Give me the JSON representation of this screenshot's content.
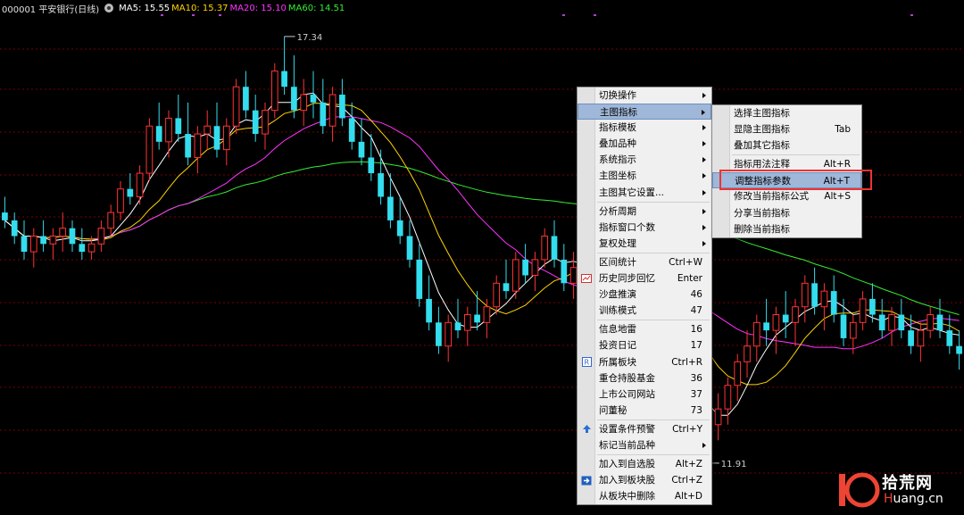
{
  "header": {
    "title": "000001 平安银行(日线)",
    "ma": [
      {
        "label": "MA5: 15.55",
        "color": "#ffffff"
      },
      {
        "label": "MA10: 15.37",
        "color": "#ffd400"
      },
      {
        "label": "MA20: 15.10",
        "color": "#ff33ff"
      },
      {
        "label": "MA60: 14.51",
        "color": "#33ee33"
      }
    ]
  },
  "annotations": {
    "high": "17.34",
    "low": "11.91"
  },
  "colors": {
    "up": "#ff3333",
    "down": "#33ddee",
    "grid": "#7a0000",
    "ma5": "#ffffff",
    "ma10": "#ffd400",
    "ma20": "#ff33ff",
    "ma60": "#33ee33"
  },
  "main_menu": {
    "items": [
      {
        "label": "切换操作",
        "arrow": true
      },
      {
        "label": "主图指标",
        "arrow": true,
        "highlight": true
      },
      {
        "label": "指标模板",
        "arrow": true
      },
      {
        "label": "叠加品种",
        "arrow": true
      },
      {
        "label": "系统指示",
        "arrow": true
      },
      {
        "label": "主图坐标",
        "arrow": true
      },
      {
        "label": "主图其它设置...",
        "arrow": true,
        "sep_after": true
      },
      {
        "label": "分析周期",
        "arrow": true
      },
      {
        "label": "指标窗口个数",
        "arrow": true
      },
      {
        "label": "复权处理",
        "arrow": true,
        "sep_after": true
      },
      {
        "label": "区间统计",
        "shortcut": "Ctrl+W"
      },
      {
        "label": "历史同步回忆",
        "shortcut": "Enter",
        "icon": "history-icon"
      },
      {
        "label": "沙盘推演",
        "shortcut": "46"
      },
      {
        "label": "训练模式",
        "shortcut": "47",
        "sep_after": true
      },
      {
        "label": "信息地雷",
        "shortcut": "16"
      },
      {
        "label": "投资日记",
        "shortcut": "17"
      },
      {
        "label": "所属板块",
        "shortcut": "Ctrl+R",
        "icon": "sector-icon"
      },
      {
        "label": "重仓持股基金",
        "shortcut": "36"
      },
      {
        "label": "上市公司网站",
        "shortcut": "37"
      },
      {
        "label": "问董秘",
        "shortcut": "73",
        "sep_after": true
      },
      {
        "label": "设置条件预警",
        "shortcut": "Ctrl+Y",
        "icon": "alert-icon"
      },
      {
        "label": "标记当前品种",
        "arrow": true,
        "sep_after": true
      },
      {
        "label": "加入到自选股",
        "shortcut": "Alt+Z"
      },
      {
        "label": "加入到板块股",
        "shortcut": "Ctrl+Z",
        "icon": "add-to-sector-icon"
      },
      {
        "label": "从板块中删除",
        "shortcut": "Alt+D"
      }
    ]
  },
  "sub_menu": {
    "items": [
      {
        "label": "选择主图指标"
      },
      {
        "label": "显隐主图指标",
        "shortcut": "Tab"
      },
      {
        "label": "叠加其它指标",
        "sep_after": true
      },
      {
        "label": "指标用法注释",
        "shortcut": "Alt+R"
      },
      {
        "label": "调整指标参数",
        "shortcut": "Alt+T",
        "highlight": true
      },
      {
        "label": "修改当前指标公式",
        "shortcut": "Alt+S"
      },
      {
        "label": "分享当前指标"
      },
      {
        "label": "删除当前指标"
      }
    ]
  },
  "watermark": {
    "logo_text": "10",
    "cn_text": "拾荒网",
    "url_h": "H",
    "url_rest": "uang.cn"
  },
  "chart_data": {
    "type": "candlestick",
    "ylim": [
      11.5,
      17.6
    ],
    "candles": [
      [
        15.1,
        15.3,
        14.9,
        15.0
      ],
      [
        15.0,
        15.1,
        14.7,
        14.8
      ],
      [
        14.8,
        15.0,
        14.5,
        14.6
      ],
      [
        14.6,
        14.9,
        14.4,
        14.8
      ],
      [
        14.8,
        15.0,
        14.6,
        14.7
      ],
      [
        14.7,
        14.9,
        14.5,
        14.8
      ],
      [
        14.8,
        15.1,
        14.6,
        14.9
      ],
      [
        14.9,
        15.0,
        14.6,
        14.7
      ],
      [
        14.7,
        14.9,
        14.5,
        14.6
      ],
      [
        14.6,
        14.8,
        14.5,
        14.7
      ],
      [
        14.7,
        15.0,
        14.6,
        14.9
      ],
      [
        14.9,
        15.2,
        14.8,
        15.1
      ],
      [
        15.1,
        15.5,
        15.0,
        15.4
      ],
      [
        15.4,
        15.6,
        15.2,
        15.3
      ],
      [
        15.3,
        15.7,
        15.2,
        15.6
      ],
      [
        15.6,
        16.3,
        15.5,
        16.2
      ],
      [
        16.2,
        16.5,
        15.9,
        16.0
      ],
      [
        16.0,
        16.4,
        15.8,
        16.3
      ],
      [
        16.3,
        16.6,
        16.0,
        16.1
      ],
      [
        16.1,
        16.5,
        15.7,
        15.8
      ],
      [
        15.8,
        16.2,
        15.6,
        16.1
      ],
      [
        16.1,
        16.4,
        15.9,
        16.2
      ],
      [
        16.2,
        16.5,
        15.8,
        15.9
      ],
      [
        15.9,
        16.3,
        15.7,
        16.2
      ],
      [
        16.2,
        16.8,
        16.1,
        16.7
      ],
      [
        16.7,
        16.9,
        16.3,
        16.4
      ],
      [
        16.4,
        16.6,
        16.0,
        16.1
      ],
      [
        16.1,
        16.5,
        15.9,
        16.4
      ],
      [
        16.4,
        17.0,
        16.3,
        16.9
      ],
      [
        16.9,
        17.34,
        16.6,
        16.7
      ],
      [
        16.7,
        17.1,
        16.3,
        16.4
      ],
      [
        16.4,
        16.8,
        16.2,
        16.6
      ],
      [
        16.6,
        16.9,
        16.3,
        16.5
      ],
      [
        16.5,
        16.8,
        16.1,
        16.2
      ],
      [
        16.2,
        16.7,
        16.0,
        16.6
      ],
      [
        16.6,
        16.8,
        16.2,
        16.3
      ],
      [
        16.3,
        16.5,
        15.9,
        16.0
      ],
      [
        16.0,
        16.3,
        15.7,
        15.8
      ],
      [
        15.8,
        16.1,
        15.5,
        15.6
      ],
      [
        15.6,
        15.9,
        15.2,
        15.3
      ],
      [
        15.3,
        15.6,
        14.9,
        15.0
      ],
      [
        15.0,
        15.3,
        14.7,
        14.8
      ],
      [
        14.8,
        15.0,
        14.4,
        14.5
      ],
      [
        14.5,
        14.7,
        13.9,
        14.0
      ],
      [
        14.0,
        14.3,
        13.6,
        13.7
      ],
      [
        13.7,
        13.9,
        13.3,
        13.4
      ],
      [
        13.4,
        13.8,
        13.2,
        13.7
      ],
      [
        13.7,
        14.0,
        13.5,
        13.6
      ],
      [
        13.6,
        13.9,
        13.4,
        13.8
      ],
      [
        13.8,
        14.1,
        13.6,
        13.7
      ],
      [
        13.7,
        14.0,
        13.5,
        13.9
      ],
      [
        13.9,
        14.3,
        13.8,
        14.2
      ],
      [
        14.2,
        14.5,
        14.0,
        14.1
      ],
      [
        14.1,
        14.6,
        14.0,
        14.5
      ],
      [
        14.5,
        14.7,
        14.2,
        14.3
      ],
      [
        14.3,
        14.6,
        14.1,
        14.5
      ],
      [
        14.5,
        14.9,
        14.4,
        14.8
      ],
      [
        14.8,
        15.0,
        14.4,
        14.5
      ],
      [
        14.5,
        14.7,
        14.1,
        14.2
      ],
      [
        14.2,
        14.6,
        14.0,
        14.4
      ],
      [
        14.4,
        14.8,
        14.2,
        14.3
      ],
      [
        14.3,
        14.6,
        14.0,
        14.1
      ],
      [
        14.1,
        14.4,
        13.8,
        14.3
      ],
      [
        14.3,
        14.7,
        14.1,
        14.6
      ],
      [
        14.6,
        15.0,
        14.3,
        14.4
      ],
      [
        14.4,
        14.6,
        14.0,
        14.1
      ],
      [
        14.1,
        14.3,
        13.7,
        13.8
      ],
      [
        13.8,
        14.1,
        13.5,
        13.9
      ],
      [
        13.9,
        14.2,
        13.6,
        13.7
      ],
      [
        13.7,
        13.9,
        13.2,
        13.3
      ],
      [
        13.3,
        13.5,
        12.8,
        12.9
      ],
      [
        12.9,
        13.1,
        12.4,
        12.5
      ],
      [
        12.5,
        12.8,
        12.1,
        12.2
      ],
      [
        12.2,
        12.6,
        11.91,
        12.4
      ],
      [
        12.4,
        12.8,
        12.2,
        12.6
      ],
      [
        12.6,
        13.0,
        12.4,
        12.9
      ],
      [
        12.9,
        13.3,
        12.7,
        13.2
      ],
      [
        13.2,
        13.6,
        13.0,
        13.4
      ],
      [
        13.4,
        13.8,
        13.2,
        13.7
      ],
      [
        13.7,
        14.0,
        13.4,
        13.6
      ],
      [
        13.6,
        13.9,
        13.3,
        13.8
      ],
      [
        13.8,
        14.1,
        13.5,
        13.7
      ],
      [
        13.7,
        14.0,
        13.4,
        13.9
      ],
      [
        13.9,
        14.3,
        13.7,
        14.2
      ],
      [
        14.2,
        14.4,
        13.8,
        13.9
      ],
      [
        13.9,
        14.2,
        13.6,
        14.1
      ],
      [
        14.1,
        14.3,
        13.7,
        13.8
      ],
      [
        13.8,
        14.0,
        13.4,
        13.5
      ],
      [
        13.5,
        13.8,
        13.3,
        13.7
      ],
      [
        13.7,
        14.1,
        13.6,
        14.0
      ],
      [
        14.0,
        14.2,
        13.7,
        13.8
      ],
      [
        13.8,
        14.0,
        13.5,
        13.6
      ],
      [
        13.6,
        13.9,
        13.4,
        13.8
      ],
      [
        13.8,
        14.0,
        13.5,
        13.6
      ],
      [
        13.6,
        13.8,
        13.3,
        13.4
      ],
      [
        13.4,
        13.7,
        13.2,
        13.6
      ],
      [
        13.6,
        13.9,
        13.5,
        13.8
      ],
      [
        13.8,
        14.0,
        13.5,
        13.6
      ],
      [
        13.6,
        13.8,
        13.3,
        13.4
      ],
      [
        13.4,
        13.6,
        13.1,
        13.3
      ]
    ]
  }
}
